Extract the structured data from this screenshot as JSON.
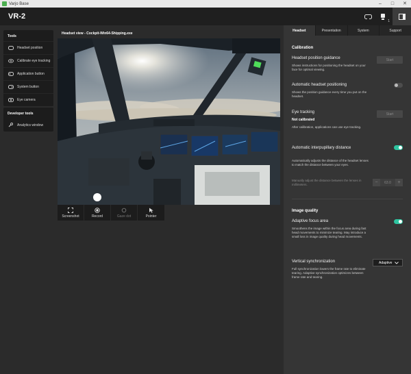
{
  "titlebar": {
    "app_title": "Varjo Base",
    "minimize": "–",
    "maximize": "□",
    "close": "✕"
  },
  "header": {
    "device_name": "VR-2",
    "icons": [
      "headset-icon",
      "user-icon",
      "panel-toggle-icon"
    ],
    "user_badge": "1"
  },
  "sidebar": {
    "tools_title": "Tools",
    "tools": [
      {
        "label": "Headset position",
        "icon": "headset-position-icon"
      },
      {
        "label": "Calibrate eye tracking",
        "icon": "eye-tracking-icon"
      },
      {
        "label": "Application button",
        "icon": "application-button-icon"
      },
      {
        "label": "System button",
        "icon": "system-button-icon"
      },
      {
        "label": "Eye camera",
        "icon": "eye-camera-icon"
      }
    ],
    "dev_title": "Developer tools",
    "dev_tools": [
      {
        "label": "Analytics window",
        "icon": "wrench-icon"
      }
    ]
  },
  "view": {
    "title": "Headset view - Cockpit-Win64-Shipping.exe",
    "toolbar": [
      {
        "label": "Screenshot",
        "icon": "screenshot-icon",
        "enabled": true
      },
      {
        "label": "Record",
        "icon": "record-icon",
        "enabled": true
      },
      {
        "label": "Gaze dot",
        "icon": "gaze-dot-icon",
        "enabled": false
      },
      {
        "label": "Pointer",
        "icon": "pointer-icon",
        "enabled": true
      }
    ]
  },
  "panel": {
    "tabs": [
      "Headset",
      "Presentation",
      "System",
      "Support"
    ],
    "active_tab": "Headset",
    "calibration": {
      "title": "Calibration",
      "guidance_title": "Headset position guidance",
      "guidance_desc": "Shows instructions for positioning the headset on your face for optimal viewing.",
      "start_label": "Start",
      "auto_title": "Automatic headset positioning",
      "auto_desc": "Shows the position guidance every time you put on the headset.",
      "auto_on": false,
      "eye_title": "Eye tracking",
      "eye_status": "Not calibrated",
      "eye_desc": "After calibration, applications can use eye tracking.",
      "ipd_title": "Automatic interpupillary distance",
      "ipd_desc": "Automatically adjusts the distance of the headset lenses to match the distance between your eyes.",
      "ipd_on": true,
      "manual_desc": "Manually adjust the distance between the lenses in millimeters.",
      "ipd_value": "63.0",
      "minus": "−",
      "plus": "+"
    },
    "image_quality": {
      "title": "Image quality",
      "afa_title": "Adaptive focus area",
      "afa_desc": "Smoothens the image within the focus area during fast head movements to minimize tearing. May introduce a small loss in image quality during head movements.",
      "afa_on": true,
      "vsync_title": "Vertical synchronization",
      "vsync_desc": "Full synchronization lowers the frame rate to eliminate tearing. Adaptive synchronization optimizes between frame rate and tearing.",
      "vsync_value": "Adaptive"
    }
  },
  "colors": {
    "accent": "#2ec4a0",
    "panel_bg": "#353535",
    "app_bg": "#2b2b2b",
    "header_bg": "#1f1f1f"
  }
}
